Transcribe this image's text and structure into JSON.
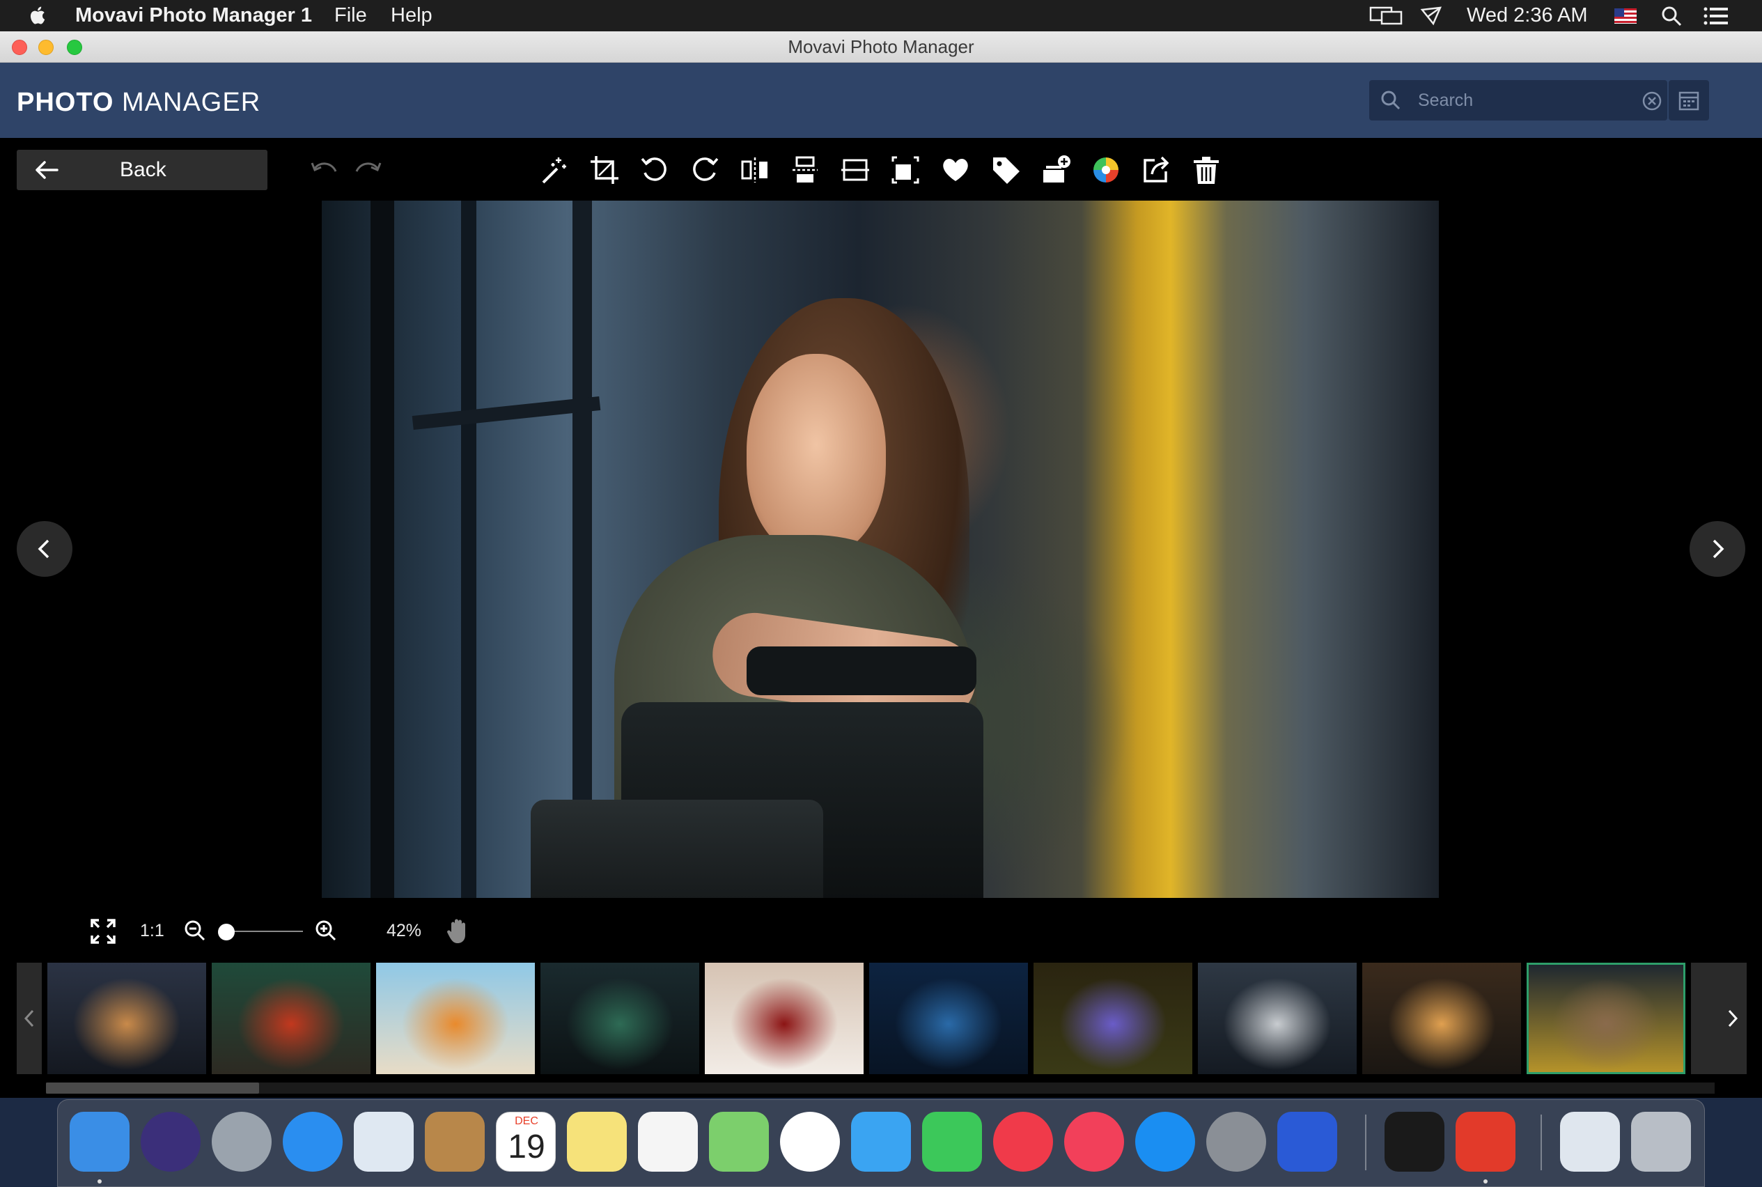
{
  "menubar": {
    "app_name": "Movavi Photo Manager 1",
    "menus": [
      "File",
      "Help"
    ],
    "clock": "Wed 2:36 AM"
  },
  "window": {
    "title": "Movavi Photo Manager"
  },
  "header": {
    "brand_bold": "PHOTO",
    "brand_light": "MANAGER",
    "search_placeholder": "Search"
  },
  "toolbar": {
    "back_label": "Back",
    "tools": [
      "magic-wand-icon",
      "crop-icon",
      "rotate-left-icon",
      "rotate-right-icon",
      "flip-horizontal-icon",
      "flip-vertical-icon",
      "straighten-icon",
      "resize-icon",
      "heart-icon",
      "tag-icon",
      "add-to-album-icon",
      "color-icon",
      "share-icon",
      "trash-icon"
    ]
  },
  "zoom": {
    "actual_size_label": "1:1",
    "percent_label": "42%",
    "level": 0.42
  },
  "filmstrip": {
    "thumbnails": [
      {
        "name": "thumb-ship-sunset",
        "colors": [
          "#2b3344",
          "#c98a4a",
          "#141820"
        ]
      },
      {
        "name": "thumb-woman-red-dress",
        "colors": [
          "#1f4a3a",
          "#c2381e",
          "#2d2a22"
        ]
      },
      {
        "name": "thumb-woman-beach",
        "colors": [
          "#8fc8e6",
          "#e98a2c",
          "#e8dcc6"
        ]
      },
      {
        "name": "thumb-aurora-lake",
        "colors": [
          "#1a2a2e",
          "#2e6b55",
          "#0c1214"
        ]
      },
      {
        "name": "thumb-cherries",
        "colors": [
          "#d6c3b3",
          "#8c1414",
          "#f2ece6"
        ]
      },
      {
        "name": "thumb-waterfall-blue",
        "colors": [
          "#0d2340",
          "#2a6aa8",
          "#081424"
        ]
      },
      {
        "name": "thumb-purple-flowers",
        "colors": [
          "#2a2410",
          "#6a5cc8",
          "#3a3a16"
        ]
      },
      {
        "name": "thumb-wolf-waterfall",
        "colors": [
          "#2e3844",
          "#c8ccd0",
          "#141a22"
        ]
      },
      {
        "name": "thumb-forest-sunset",
        "colors": [
          "#3a2a1c",
          "#e0a050",
          "#1a1612"
        ]
      },
      {
        "name": "thumb-woman-bus",
        "colors": [
          "#1c2630",
          "#8a6a4c",
          "#b8952a"
        ]
      }
    ],
    "selected_index": 9
  },
  "dock": {
    "apps": [
      {
        "name": "finder",
        "color": "#3a8ee6"
      },
      {
        "name": "siri",
        "color": "#3b2f7a"
      },
      {
        "name": "launchpad",
        "color": "#9aa3ad"
      },
      {
        "name": "safari",
        "color": "#2a8ef0"
      },
      {
        "name": "mail",
        "color": "#dfe8f2"
      },
      {
        "name": "contacts",
        "color": "#b8874a"
      },
      {
        "name": "calendar",
        "color": "#ffffff"
      },
      {
        "name": "notes",
        "color": "#f6e27a"
      },
      {
        "name": "reminders",
        "color": "#f5f5f5"
      },
      {
        "name": "maps",
        "color": "#7ccf6c"
      },
      {
        "name": "photos",
        "color": "#ffffff"
      },
      {
        "name": "messages",
        "color": "#3aa4f2"
      },
      {
        "name": "facetime",
        "color": "#3cc85a"
      },
      {
        "name": "news",
        "color": "#f03a4a"
      },
      {
        "name": "music",
        "color": "#f2405a"
      },
      {
        "name": "app-store",
        "color": "#1a8ef2"
      },
      {
        "name": "system-preferences",
        "color": "#8a8f96"
      },
      {
        "name": "magnet",
        "color": "#2a5ad6"
      },
      {
        "name": "terminal",
        "color": "#1a1a1a"
      },
      {
        "name": "angry-bird",
        "color": "#e23a2a"
      },
      {
        "name": "preview",
        "color": "#dfe6ee"
      },
      {
        "name": "trash",
        "color": "#b8bec6"
      }
    ],
    "calendar_month": "DEC",
    "calendar_day": "19"
  }
}
